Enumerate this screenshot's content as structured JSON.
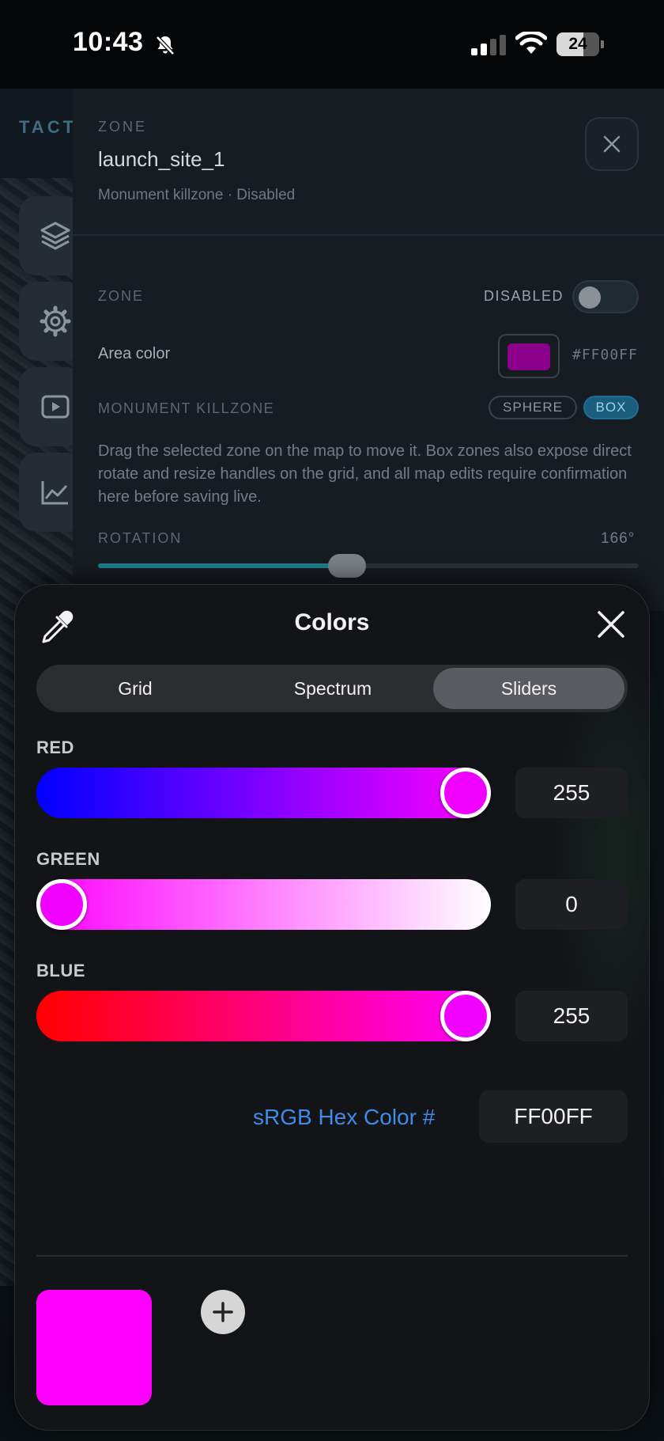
{
  "status_bar": {
    "time": "10:43",
    "battery": "24"
  },
  "background_app": {
    "brand": "TACT",
    "zone_panel": {
      "kicker": "ZONE",
      "name": "launch_site_1",
      "subtitle": "Monument killzone · Disabled",
      "zone_section_label": "ZONE",
      "toggle_label": "DISABLED",
      "toggle_on": false,
      "area_color_label": "Area color",
      "area_color_hex": "#FF00FF",
      "monument_label": "MONUMENT KILLZONE",
      "shape_options": [
        "SPHERE",
        "BOX"
      ],
      "selected_shape": "BOX",
      "description": "Drag the selected zone on the map to move it. Box zones also expose direct rotate and resize handles on the grid, and all map edits require confirmation here before saving live.",
      "rotation_label": "ROTATION",
      "rotation_value": "166°",
      "rotation_degrees": 166
    },
    "side_buttons": [
      "layers-icon",
      "gear-icon",
      "play-icon",
      "chart-icon"
    ]
  },
  "color_picker": {
    "title": "Colors",
    "tabs": [
      "Grid",
      "Spectrum",
      "Sliders"
    ],
    "active_tab": "Sliders",
    "channels": [
      {
        "label": "RED",
        "value": "255",
        "fraction": 1.0
      },
      {
        "label": "GREEN",
        "value": "0",
        "fraction": 0.0
      },
      {
        "label": "BLUE",
        "value": "255",
        "fraction": 1.0
      }
    ],
    "hex_label": "sRGB Hex Color #",
    "hex_value": "FF00FF",
    "current_color": "#FF00FF",
    "accent_link_color": "#3F8BE8"
  }
}
